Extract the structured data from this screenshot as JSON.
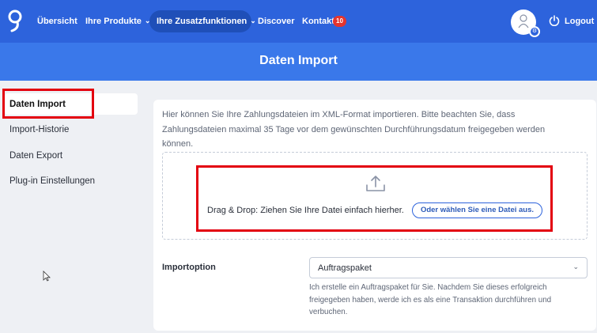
{
  "nav": {
    "overview": "Übersicht",
    "products": "Ihre Produkte",
    "addons": "Ihre Zusatzfunktionen",
    "discover": "Discover",
    "contact": "Kontakt",
    "contact_badge": "10",
    "logout": "Logout"
  },
  "banner": {
    "title": "Daten Import"
  },
  "sidebar": {
    "items": [
      {
        "label": "Daten Import",
        "active": true
      },
      {
        "label": "Import-Historie"
      },
      {
        "label": "Daten Export"
      },
      {
        "label": "Plug-in Einstellungen"
      }
    ]
  },
  "main": {
    "intro": "Hier können Sie Ihre Zahlungsdateien im XML-Format importieren. Bitte beachten Sie, dass Zahlungsdateien maximal 35 Tage vor dem gewünschten Durchführungsdatum freigegeben werden können.",
    "drop_text": "Drag & Drop: Ziehen Sie Ihre Datei einfach hierher.",
    "choose_button": "Oder wählen Sie eine Datei aus.",
    "import_option_label": "Importoption",
    "import_option_value": "Auftragspaket",
    "import_option_desc": "Ich erstelle ein Auftragspaket für Sie. Nachdem Sie dieses erfolgreich freigegeben haben, werde ich es als eine Transaktion durchführen und verbuchen."
  },
  "colors": {
    "nav_bg": "#2d63dc",
    "banner_bg": "#3a78ea",
    "highlight": "#e3000f",
    "badge": "#e3342f"
  }
}
